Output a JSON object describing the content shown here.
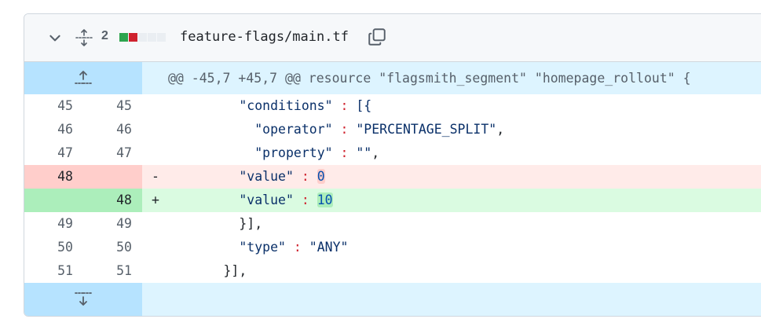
{
  "header": {
    "changed_count": "2",
    "filename": "feature-flags/main.tf",
    "diffstat": [
      "#2da44e",
      "#cf222e",
      "#eaeef2",
      "#eaeef2",
      "#eaeef2"
    ]
  },
  "hunk": {
    "header": "@@ -45,7 +45,7 @@ resource \"flagsmith_segment\" \"homepage_rollout\" {"
  },
  "lines": [
    {
      "old": "45",
      "new": "45",
      "type": "ctx",
      "indent": "          ",
      "key": "\"conditions\"",
      "colon": " : ",
      "value": "[{",
      "tail": ""
    },
    {
      "old": "46",
      "new": "46",
      "type": "ctx",
      "indent": "            ",
      "key": "\"operator\"",
      "colon": " : ",
      "value": "\"PERCENTAGE_SPLIT\"",
      "tail": ","
    },
    {
      "old": "47",
      "new": "47",
      "type": "ctx",
      "indent": "            ",
      "key": "\"property\"",
      "colon": " : ",
      "value": "\"\"",
      "tail": ","
    },
    {
      "old": "48",
      "new": "",
      "type": "del",
      "sign": "-",
      "indent": "          ",
      "key": "\"value\"",
      "colon": " : ",
      "value": "0",
      "tail": ""
    },
    {
      "old": "",
      "new": "48",
      "type": "add",
      "sign": "+",
      "indent": "          ",
      "key": "\"value\"",
      "colon": " : ",
      "value": "10",
      "tail": ""
    },
    {
      "old": "49",
      "new": "49",
      "type": "ctx",
      "indent": "          ",
      "key": "",
      "colon": "",
      "value": "}],",
      "tail": ""
    },
    {
      "old": "50",
      "new": "50",
      "type": "ctx",
      "indent": "          ",
      "key": "\"type\"",
      "colon": " : ",
      "value": "\"ANY\"",
      "tail": ""
    },
    {
      "old": "51",
      "new": "51",
      "type": "ctx",
      "indent": "        ",
      "key": "",
      "colon": "",
      "value": "}],",
      "tail": ""
    }
  ]
}
